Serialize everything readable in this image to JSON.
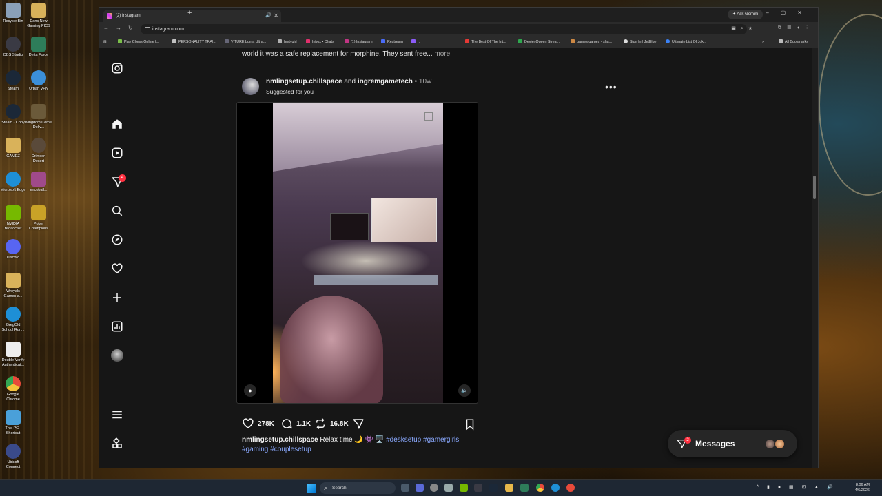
{
  "browser": {
    "tab_title": "(2) Instagram",
    "ask_gemini": "Ask Gemini",
    "url": "instagram.com",
    "bookmarks": [
      {
        "label": "Play Chess Online f...",
        "color": "#7bbf4a"
      },
      {
        "label": "PERSONALITY TRAI...",
        "color": "#c0c0c0"
      },
      {
        "label": "VITURE Luma Ultra...",
        "color": "#666677"
      },
      {
        "label": "feetygirl",
        "color": "#b0b0b0"
      },
      {
        "label": "Inbox • Chats",
        "color": "#e1306c"
      },
      {
        "label": "(1) Instagram",
        "color": "#c13584"
      },
      {
        "label": "Restream",
        "color": "#4a6cf7"
      },
      {
        "label": "...",
        "color": "#8b5cf6"
      },
      {
        "label": "The Best Of The Int...",
        "color": "#e53935"
      },
      {
        "label": "DevienQueen Strea...",
        "color": "#2fa84f"
      },
      {
        "label": "games games - sha...",
        "color": "#cc8844"
      },
      {
        "label": "Sign In | JetBlue",
        "color": "#dddddd"
      },
      {
        "label": "Ultimate List Of Jok...",
        "color": "#3b82f6"
      },
      {
        "label": "All Bookmarks",
        "color": "#bbbbbb"
      }
    ]
  },
  "sidebar": {
    "notification_count": "4"
  },
  "prev_post": {
    "caption_tail": "world it was a safe replacement for morphine. They sent free...",
    "more": "more"
  },
  "post": {
    "user1": "nmlingsetup.chillspace",
    "and": "and",
    "user2": "ingremgametech",
    "age": "• 10w",
    "suggested": "Suggested for you",
    "likes": "278K",
    "comments": "1.1K",
    "reposts": "16.8K",
    "caption_user": "nmlingsetup.chillspace",
    "caption_text": "Relax time 🌙 👾 🖥️",
    "hashtags_line1": "#desksetup #gamergirls",
    "hashtags_line2": "#gaming #couplesetup"
  },
  "messages": {
    "label": "Messages",
    "count": "2"
  },
  "taskbar": {
    "search": "Search",
    "time": "8:06 AM",
    "date": "4/6/2026"
  },
  "desktop_icons": [
    {
      "label": "Recycle Bin",
      "color": "#8aa0b8"
    },
    {
      "label": "Dans New Gaming PICS",
      "color": "#d9b25a"
    },
    {
      "label": "OBS Studio",
      "color": "#3a3a44"
    },
    {
      "label": "Delta Force",
      "color": "#2e7d5a"
    },
    {
      "label": "Steam",
      "color": "#1b2838"
    },
    {
      "label": "Urban VPN",
      "color": "#3b8fd9"
    },
    {
      "label": "Steam - Copy",
      "color": "#1b2838"
    },
    {
      "label": "Kingdom Come Deliv...",
      "color": "#6b5a3a"
    },
    {
      "label": "GAMEZ",
      "color": "#d9b25a"
    },
    {
      "label": "Crimson Desert",
      "color": "#5a4a3a"
    },
    {
      "label": "Microsoft Edge",
      "color": "#1e8fd6"
    },
    {
      "label": "encoball...",
      "color": "#a04a8a"
    },
    {
      "label": "NVIDIA Broadcast",
      "color": "#76b900"
    },
    {
      "label": "Poker Champions",
      "color": "#c9a227"
    },
    {
      "label": "Discord",
      "color": "#5865f2"
    },
    {
      "label": "Wroyals Games a...",
      "color": "#d9b25a"
    },
    {
      "label": "GregOld School Run...",
      "color": "#1e8fd6"
    },
    {
      "label": "Double Verify Authenticat...",
      "color": "#eeeeee"
    },
    {
      "label": "Google Chrome",
      "color": "#e84a3a"
    },
    {
      "label": "This PC - Shortcut",
      "color": "#4aa0d9"
    },
    {
      "label": "Ubisoft Connect",
      "color": "#3a4a8a"
    }
  ]
}
